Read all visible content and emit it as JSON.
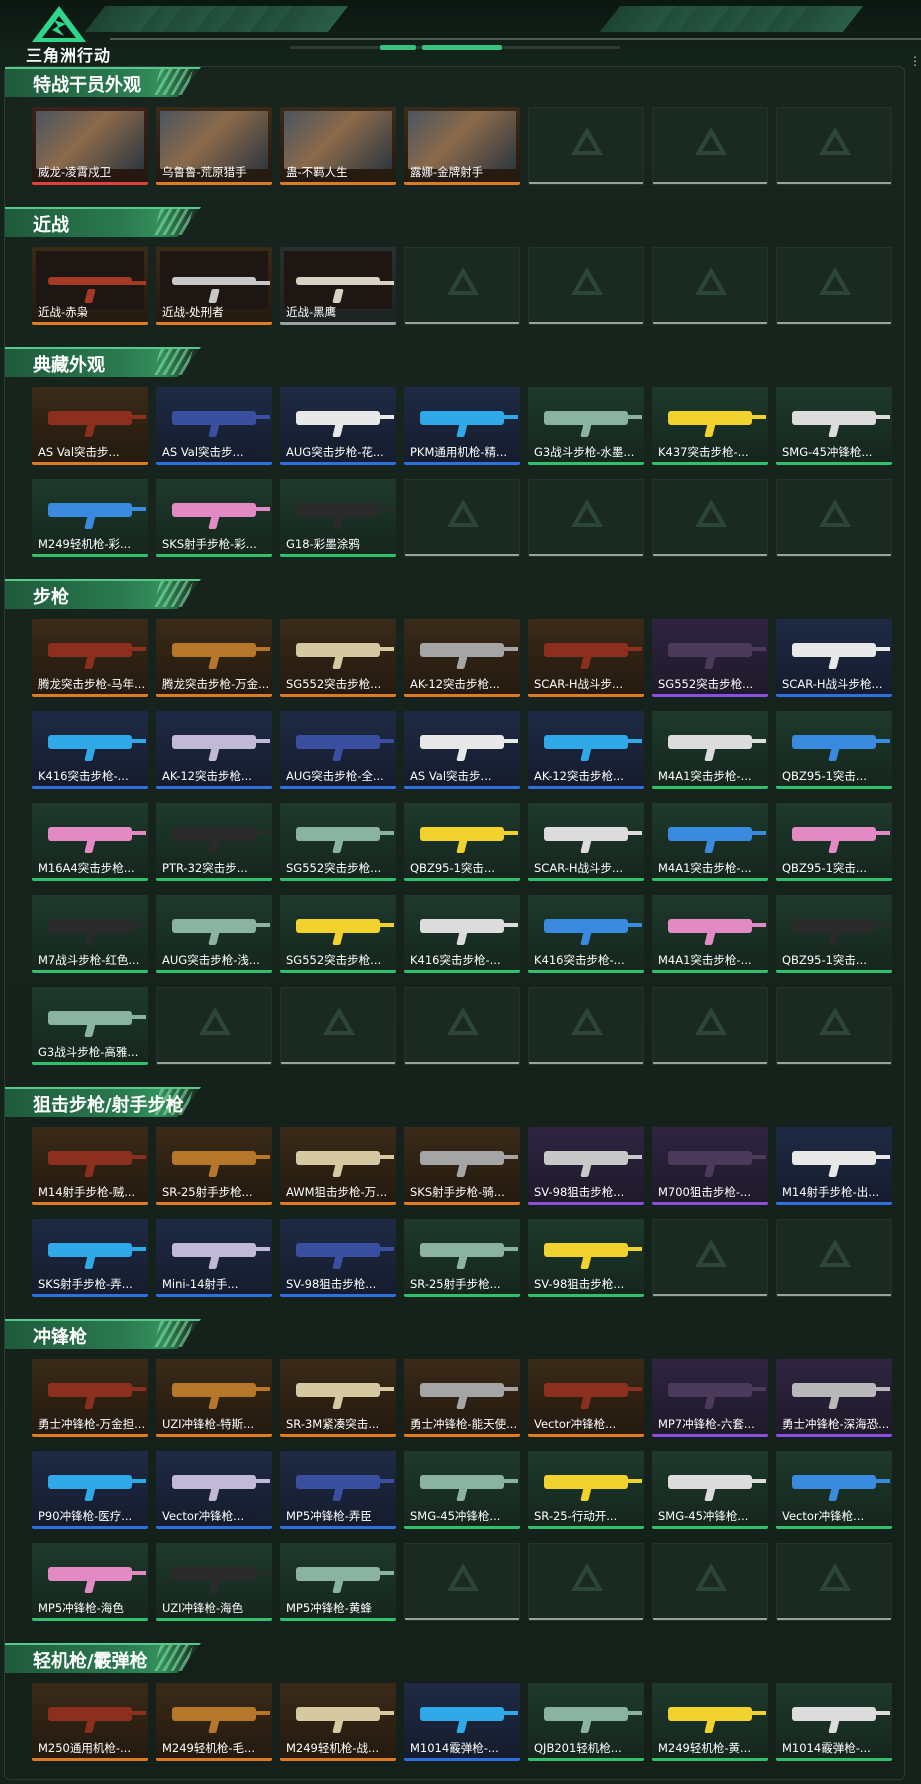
{
  "app": {
    "logo_text": "三角洲行动"
  },
  "colors": {
    "red": "#e0413a",
    "orange": "#e07b1f",
    "purple": "#8a4fe0",
    "blue": "#2f6fe0",
    "green": "#2fc26e",
    "gray": "#9aa29e",
    "accent": "#39c27f"
  },
  "sections": [
    {
      "title": "特战干员外观",
      "items": [
        {
          "name": "威龙-凌霄戍卫",
          "rarity": "red",
          "kind": "portrait"
        },
        {
          "name": "乌鲁鲁-荒原猎手",
          "rarity": "orange",
          "kind": "portrait"
        },
        {
          "name": "蛊-不羁人生",
          "rarity": "orange",
          "kind": "portrait"
        },
        {
          "name": "露娜-金牌射手",
          "rarity": "orange",
          "kind": "portrait"
        },
        {
          "name": "",
          "rarity": "empty"
        },
        {
          "name": "",
          "rarity": "empty"
        },
        {
          "name": "",
          "rarity": "empty"
        }
      ]
    },
    {
      "title": "近战",
      "items": [
        {
          "name": "近战-赤枭",
          "rarity": "orange",
          "kind": "knife"
        },
        {
          "name": "近战-处刑者",
          "rarity": "orange",
          "kind": "knife"
        },
        {
          "name": "近战-黑鹰",
          "rarity": "gray",
          "kind": "knife"
        },
        {
          "name": "",
          "rarity": "empty"
        },
        {
          "name": "",
          "rarity": "empty"
        },
        {
          "name": "",
          "rarity": "empty"
        },
        {
          "name": "",
          "rarity": "empty"
        }
      ]
    },
    {
      "title": "典藏外观",
      "items": [
        {
          "name": "AS Val突击步...",
          "rarity": "orange"
        },
        {
          "name": "AS Val突击步...",
          "rarity": "blue"
        },
        {
          "name": "AUG突击步枪-花...",
          "rarity": "blue"
        },
        {
          "name": "PKM通用机枪-精...",
          "rarity": "blue"
        },
        {
          "name": "G3战斗步枪-水墨...",
          "rarity": "green"
        },
        {
          "name": "K437突击步枪-...",
          "rarity": "green"
        },
        {
          "name": "SMG-45冲锋枪...",
          "rarity": "green"
        },
        {
          "name": "M249轻机枪-彩...",
          "rarity": "green"
        },
        {
          "name": "SKS射手步枪-彩...",
          "rarity": "green"
        },
        {
          "name": "G18-彩墨涂鸦",
          "rarity": "green"
        },
        {
          "name": "",
          "rarity": "empty"
        },
        {
          "name": "",
          "rarity": "empty"
        },
        {
          "name": "",
          "rarity": "empty"
        },
        {
          "name": "",
          "rarity": "empty"
        }
      ]
    },
    {
      "title": "步枪",
      "items": [
        {
          "name": "腾龙突击步枪-马年...",
          "rarity": "orange"
        },
        {
          "name": "腾龙突击步枪-万金...",
          "rarity": "orange"
        },
        {
          "name": "SG552突击步枪...",
          "rarity": "orange"
        },
        {
          "name": "AK-12突击步枪...",
          "rarity": "orange"
        },
        {
          "name": "SCAR-H战斗步...",
          "rarity": "orange"
        },
        {
          "name": "SG552突击步枪...",
          "rarity": "purple"
        },
        {
          "name": "SCAR-H战斗步枪...",
          "rarity": "blue"
        },
        {
          "name": "K416突击步枪-...",
          "rarity": "blue"
        },
        {
          "name": "AK-12突击步枪...",
          "rarity": "blue"
        },
        {
          "name": "AUG突击步枪-全...",
          "rarity": "blue"
        },
        {
          "name": "AS Val突击步...",
          "rarity": "blue"
        },
        {
          "name": "AK-12突击步枪...",
          "rarity": "blue"
        },
        {
          "name": "M4A1突击步枪-...",
          "rarity": "green"
        },
        {
          "name": "QBZ95-1突击...",
          "rarity": "green"
        },
        {
          "name": "M16A4突击步枪...",
          "rarity": "green"
        },
        {
          "name": "PTR-32突击步...",
          "rarity": "green"
        },
        {
          "name": "SG552突击步枪...",
          "rarity": "green"
        },
        {
          "name": "QBZ95-1突击...",
          "rarity": "green"
        },
        {
          "name": "SCAR-H战斗步...",
          "rarity": "green"
        },
        {
          "name": "M4A1突击步枪-...",
          "rarity": "green"
        },
        {
          "name": "QBZ95-1突击...",
          "rarity": "green"
        },
        {
          "name": "M7战斗步枪-红色...",
          "rarity": "green"
        },
        {
          "name": "AUG突击步枪-浅...",
          "rarity": "green"
        },
        {
          "name": "SG552突击步枪...",
          "rarity": "green"
        },
        {
          "name": "K416突击步枪-...",
          "rarity": "green"
        },
        {
          "name": "K416突击步枪-...",
          "rarity": "green"
        },
        {
          "name": "M4A1突击步枪-...",
          "rarity": "green"
        },
        {
          "name": "QBZ95-1突击...",
          "rarity": "green"
        },
        {
          "name": "G3战斗步枪-高雅...",
          "rarity": "green"
        },
        {
          "name": "",
          "rarity": "empty"
        },
        {
          "name": "",
          "rarity": "empty"
        },
        {
          "name": "",
          "rarity": "empty"
        },
        {
          "name": "",
          "rarity": "empty"
        },
        {
          "name": "",
          "rarity": "empty"
        },
        {
          "name": "",
          "rarity": "empty"
        }
      ]
    },
    {
      "title": "狙击步枪/射手步枪",
      "items": [
        {
          "name": "M14射手步枪-贼...",
          "rarity": "orange"
        },
        {
          "name": "SR-25射手步枪...",
          "rarity": "orange"
        },
        {
          "name": "AWM狙击步枪-万...",
          "rarity": "orange"
        },
        {
          "name": "SKS射手步枪-骑...",
          "rarity": "orange"
        },
        {
          "name": "SV-98狙击步枪...",
          "rarity": "purple"
        },
        {
          "name": "M700狙击步枪-...",
          "rarity": "purple"
        },
        {
          "name": "M14射手步枪-出...",
          "rarity": "blue"
        },
        {
          "name": "SKS射手步枪-弄...",
          "rarity": "blue"
        },
        {
          "name": "Mini-14射手...",
          "rarity": "blue"
        },
        {
          "name": "SV-98狙击步枪...",
          "rarity": "blue"
        },
        {
          "name": "SR-25射手步枪...",
          "rarity": "green"
        },
        {
          "name": "SV-98狙击步枪...",
          "rarity": "green"
        },
        {
          "name": "",
          "rarity": "empty"
        },
        {
          "name": "",
          "rarity": "empty"
        }
      ]
    },
    {
      "title": "冲锋枪",
      "items": [
        {
          "name": "勇士冲锋枪-万金担...",
          "rarity": "orange"
        },
        {
          "name": "UZI冲锋枪-特斯...",
          "rarity": "orange"
        },
        {
          "name": "SR-3M紧凑突击...",
          "rarity": "orange"
        },
        {
          "name": "勇士冲锋枪-能天使...",
          "rarity": "orange"
        },
        {
          "name": "Vector冲锋枪...",
          "rarity": "orange"
        },
        {
          "name": "MP7冲锋枪-六套...",
          "rarity": "purple"
        },
        {
          "name": "勇士冲锋枪-深海恐...",
          "rarity": "purple"
        },
        {
          "name": "P90冲锋枪-医疗...",
          "rarity": "blue"
        },
        {
          "name": "Vector冲锋枪...",
          "rarity": "blue"
        },
        {
          "name": "MP5冲锋枪-弄臣",
          "rarity": "blue"
        },
        {
          "name": "SMG-45冲锋枪...",
          "rarity": "green"
        },
        {
          "name": "SR-25-行动开...",
          "rarity": "green"
        },
        {
          "name": "SMG-45冲锋枪...",
          "rarity": "green"
        },
        {
          "name": "Vector冲锋枪...",
          "rarity": "green"
        },
        {
          "name": "MP5冲锋枪-海色",
          "rarity": "green"
        },
        {
          "name": "UZI冲锋枪-海色",
          "rarity": "green"
        },
        {
          "name": "MP5冲锋枪-黄蜂",
          "rarity": "green"
        },
        {
          "name": "",
          "rarity": "empty"
        },
        {
          "name": "",
          "rarity": "empty"
        },
        {
          "name": "",
          "rarity": "empty"
        },
        {
          "name": "",
          "rarity": "empty"
        }
      ]
    },
    {
      "title": "轻机枪/霰弹枪",
      "items": [
        {
          "name": "M250通用机枪-...",
          "rarity": "orange"
        },
        {
          "name": "M249轻机枪-毛...",
          "rarity": "orange"
        },
        {
          "name": "M249轻机枪-战...",
          "rarity": "orange"
        },
        {
          "name": "M1014霰弹枪-...",
          "rarity": "blue"
        },
        {
          "name": "QJB201轻机枪...",
          "rarity": "green"
        },
        {
          "name": "M249轻机枪-黄...",
          "rarity": "green"
        },
        {
          "name": "M1014霰弹枪-...",
          "rarity": "green"
        }
      ]
    }
  ]
}
